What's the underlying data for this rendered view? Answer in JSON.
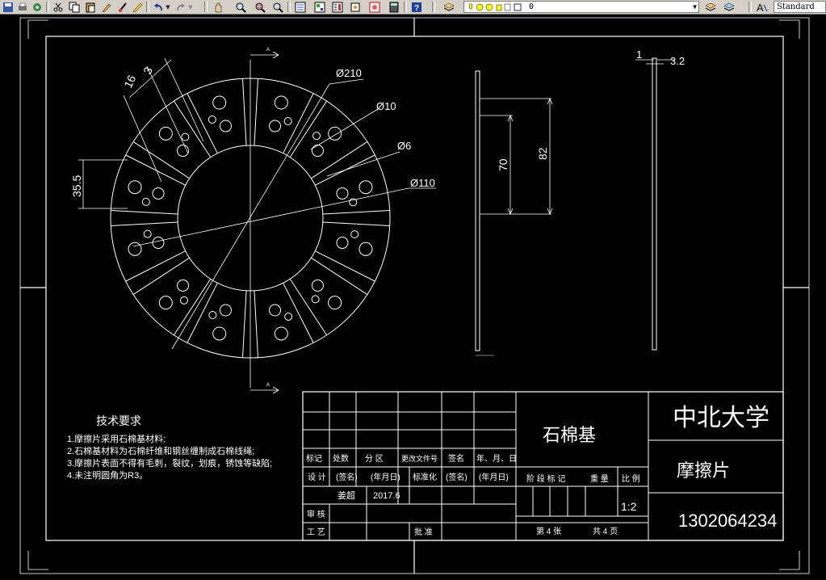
{
  "toolbar": {
    "layer_value": "0",
    "text_style": "Standard"
  },
  "dims": {
    "d210": "Ø210",
    "d10": "Ø10",
    "d6": "Ø6",
    "d110": "Ø110",
    "w16": "16",
    "w3": "3",
    "w355": "35.5",
    "h70": "70",
    "h82": "82",
    "t1": "1",
    "t32": "3.2"
  },
  "notes": {
    "title": "技术要求",
    "items": [
      "1.摩擦片采用石棉基材料;",
      "2.石棉基材料为石棉纤维和钢丝缠制成石棉线绳;",
      "3.摩擦片表面不得有毛刺，裂纹，划痕，锈蚀等缺陷;",
      "4.未注明圆角为R3。"
    ]
  },
  "title_block": {
    "material": "石棉基",
    "school": "中北大学",
    "part_name": "摩擦片",
    "drawing_no": "1302064234",
    "rev_headers": [
      "标记",
      "处数",
      "分 区",
      "更改文件号",
      "签名",
      "年、月、日"
    ],
    "design_row": [
      "设 计",
      "(签名)",
      "(年月日)",
      "标准化",
      "(签名)",
      "(年月日)"
    ],
    "designer": "姜超",
    "design_date": "2017.6",
    "check": "审 核",
    "process": "工 艺",
    "approve": "批 准",
    "stage_headers": [
      "阶 段 标 记",
      "重 量",
      "比 例"
    ],
    "scale": "1:2",
    "sheet": "第 4 张",
    "total": "共 4 页"
  }
}
